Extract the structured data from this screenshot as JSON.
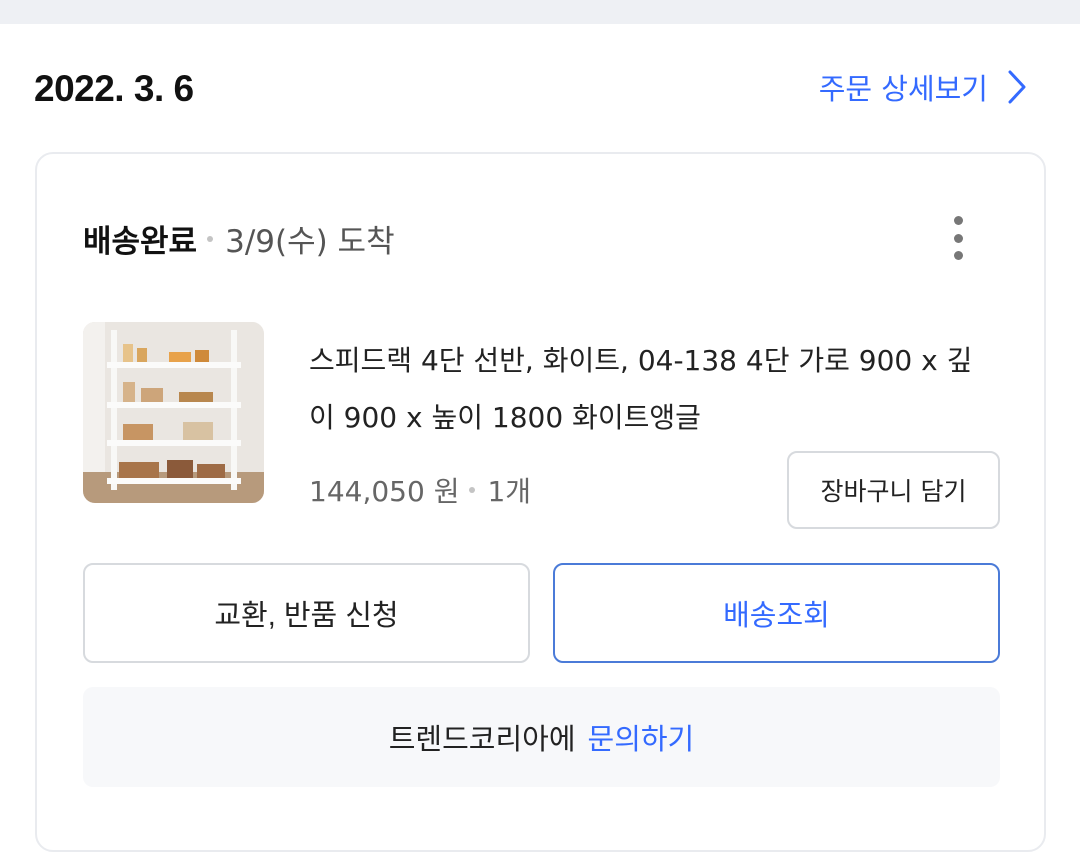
{
  "order": {
    "date": "2022. 3. 6",
    "detail_link_label": "주문 상세보기"
  },
  "shipment": {
    "status": "배송완료",
    "arrival": "3/9(수) 도착"
  },
  "product": {
    "title": "스피드랙 4단 선반, 화이트, 04-138 4단 가로 900 x 깊이 900 x 높이 1800 화이트앵글",
    "price": "144,050 원",
    "quantity": "1개"
  },
  "buttons": {
    "add_to_cart": "장바구니 담기",
    "exchange_return": "교환, 반품 신청",
    "track_delivery": "배송조회"
  },
  "inquiry": {
    "prefix": "트렌드코리아에",
    "link": "문의하기"
  },
  "icons": {
    "chevron": "chevron-right-icon",
    "more": "more-vertical-icon"
  },
  "colors": {
    "accent": "#346aff",
    "track_border": "#4b7bd8"
  }
}
